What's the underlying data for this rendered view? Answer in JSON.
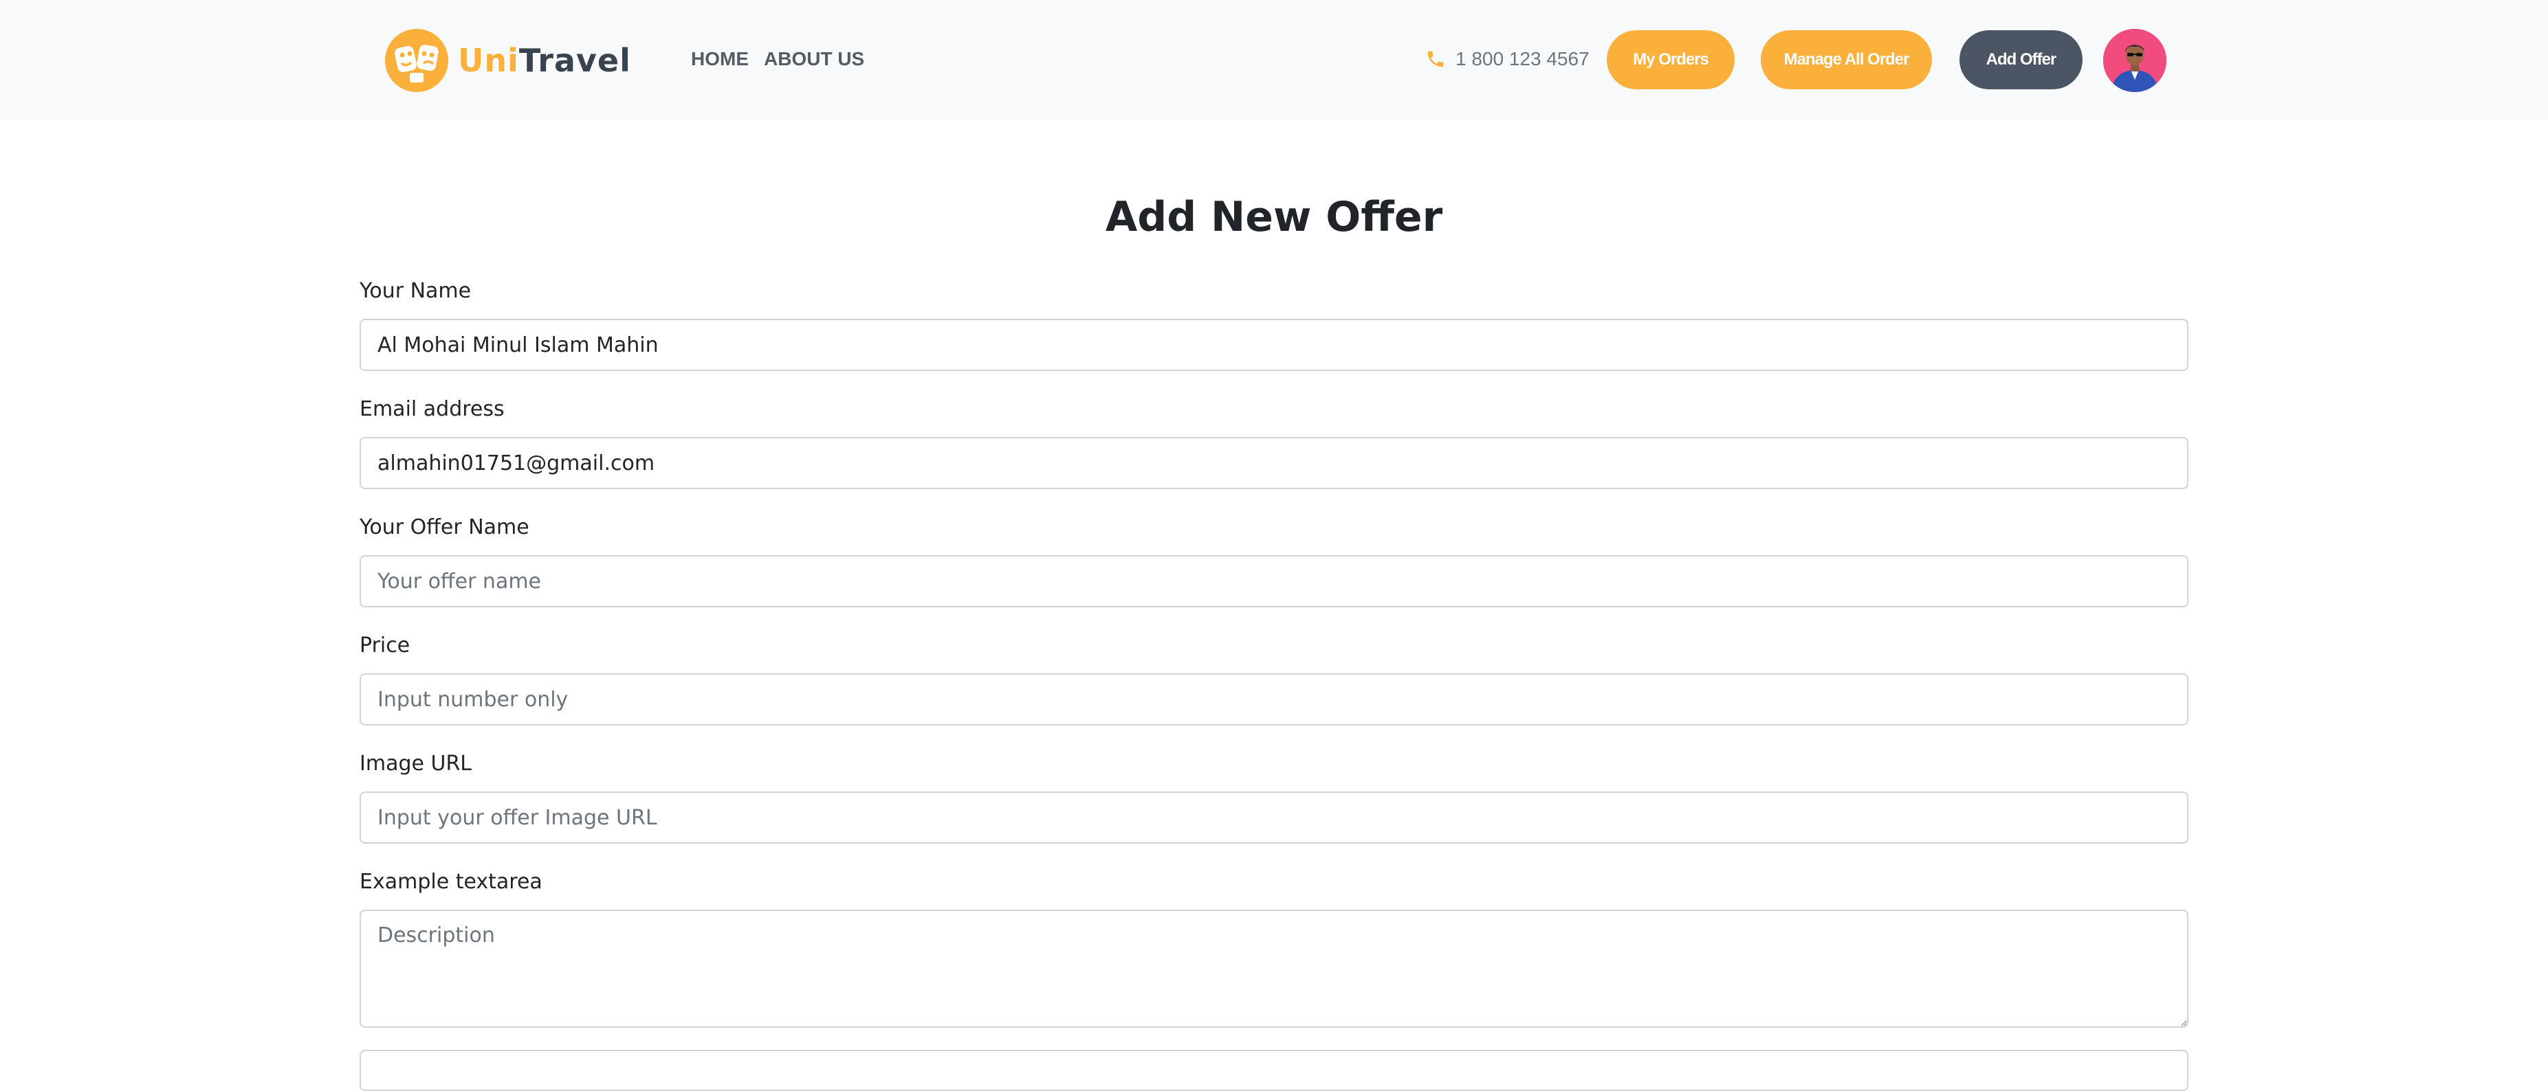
{
  "brand": {
    "name_part1": "Uni",
    "name_part2": "Travel",
    "logo_icon": "masks-logo-icon",
    "accent_color": "#fbb03b",
    "dark_color": "#3a4450"
  },
  "nav": {
    "links": [
      "HOME",
      "ABOUT US"
    ],
    "phone_icon": "phone-icon",
    "phone": "1 800 123 4567",
    "buttons": {
      "my_orders": "My Orders",
      "manage_all_order": "Manage All Order",
      "add_offer": "Add Offer"
    },
    "avatar_icon": "user-avatar"
  },
  "form": {
    "title": "Add New Offer",
    "fields": [
      {
        "label": "Your Name",
        "value": "Al Mohai Minul Islam Mahin",
        "placeholder": ""
      },
      {
        "label": "Email address",
        "value": "almahin01751@gmail.com",
        "placeholder": ""
      },
      {
        "label": "Your Offer Name",
        "value": "",
        "placeholder": "Your offer name"
      },
      {
        "label": "Price",
        "value": "",
        "placeholder": "Input number only"
      },
      {
        "label": "Image URL",
        "value": "",
        "placeholder": "Input your offer Image URL"
      }
    ],
    "textarea": {
      "label": "Example textarea",
      "placeholder": "Description"
    }
  },
  "colors": {
    "navbar_bg": "#f8f9fa",
    "button_orange": "#fbb03b",
    "button_dark": "#4b5563",
    "avatar_bg": "#f14c7d"
  }
}
